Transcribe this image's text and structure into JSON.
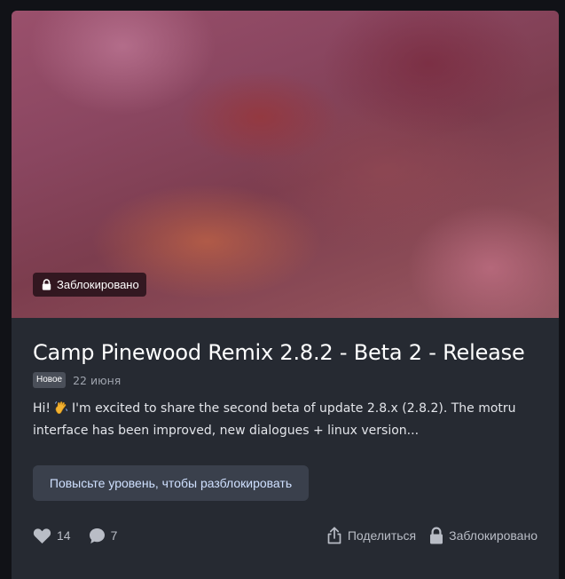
{
  "post": {
    "locked_badge": "Заблокировано",
    "title": "Camp Pinewood Remix 2.8.2 - Beta 2 - Release",
    "tag": "Новое",
    "date": "22 июня",
    "excerpt_start": "Hi!",
    "excerpt_emoji": "waving-hand-icon",
    "excerpt_rest": "I'm excited to share the second beta of update 2.8.x (2.8.2). The motru interface has been improved, new dialogues + linux version...",
    "unlock_button": "Повысьте уровень, чтобы разблокировать"
  },
  "footer": {
    "likes": "14",
    "comments": "7",
    "share_label": "Поделиться",
    "locked_label": "Заблокировано"
  },
  "colors": {
    "card_bg": "#262a32",
    "page_bg": "#111217",
    "button_bg": "#3a404c",
    "button_text": "#cfe0ff"
  }
}
